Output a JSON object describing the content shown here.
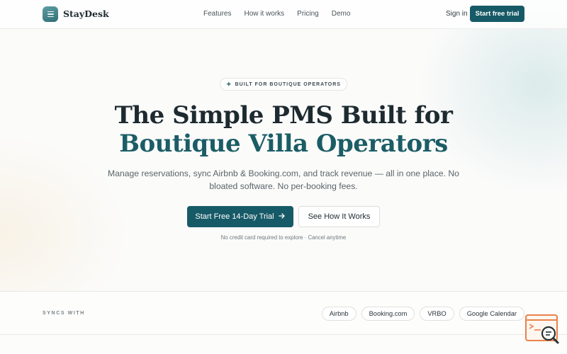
{
  "nav": {
    "brand": "StayDesk",
    "links": [
      "Features",
      "How it works",
      "Pricing",
      "Demo"
    ],
    "sign_in": "Sign in",
    "cta": "Start free trial"
  },
  "hero": {
    "badge": "BUILT FOR BOUTIQUE OPERATORS",
    "badge_icon": "sparkle-icon",
    "title_line1": "The Simple PMS Built for",
    "title_line2": "Boutique Villa Operators",
    "subtitle": "Manage reservations, sync Airbnb & Booking.com, and track revenue — all in one place. No bloated software. No per-booking fees.",
    "primary_cta": "Start Free 14-Day Trial",
    "primary_cta_icon": "arrow-right-icon",
    "secondary_cta": "See How It Works",
    "note": "No credit card required to explore · Cancel anytime"
  },
  "sync": {
    "label": "SYNCS WITH",
    "channels": [
      "Airbnb",
      "Booking.com",
      "VRBO",
      "Google Calendar"
    ]
  },
  "colors": {
    "brand": "#175a67",
    "title_accent": "#1b5d66",
    "widget_accent": "#e8824a"
  }
}
